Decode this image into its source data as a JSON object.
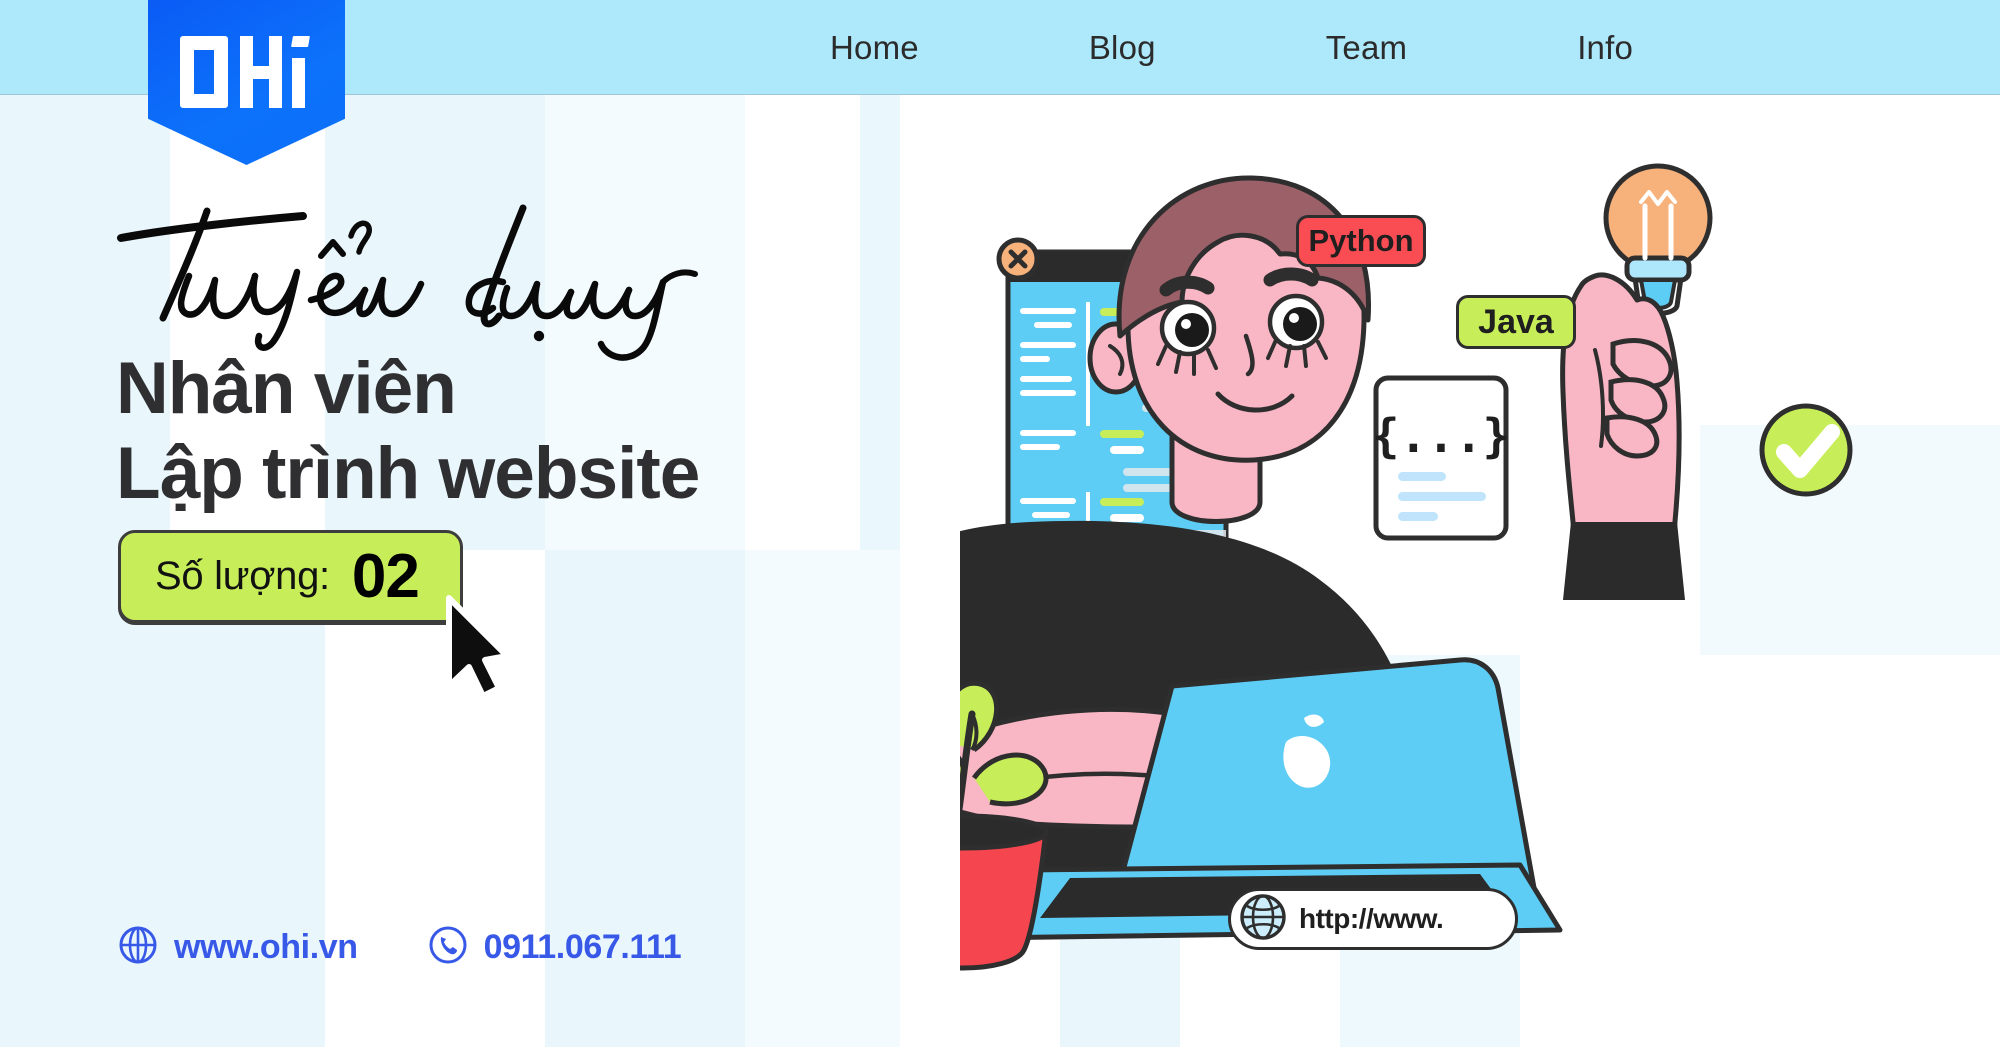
{
  "brand": {
    "logo_text": "OHi",
    "logo_color": "#0d72fb"
  },
  "nav": {
    "items": [
      {
        "label": "Home"
      },
      {
        "label": "Blog"
      },
      {
        "label": "Team"
      },
      {
        "label": "Info"
      }
    ]
  },
  "hero": {
    "script_text": "Tuyển dụng",
    "title_line1": "Nhân viên",
    "title_line2": "Lập trình website",
    "quantity_label": "Số lượng:",
    "quantity_value": "02",
    "quantity_badge_color": "#c7ee59"
  },
  "contacts": [
    {
      "icon": "globe-icon",
      "text": "www.ohi.vn"
    },
    {
      "icon": "phone-icon",
      "text": "0911.067.111"
    }
  ],
  "illustration": {
    "chips": [
      {
        "label": "Python",
        "color": "#fa4c53"
      },
      {
        "label": "Java",
        "color": "#c7ee59"
      }
    ],
    "url_chip": {
      "icon": "globe-icon",
      "text": "http://www."
    },
    "code_card_text": "{...}",
    "accent_colors": {
      "sky": "#5ecdf5",
      "pink": "#f9b6c4",
      "lime": "#c7ee59",
      "red": "#f5464f",
      "dark": "#2e2e2e",
      "hair": "#9b6068",
      "bulb": "#f7b27c"
    }
  },
  "theme": {
    "nav_bg": "#ade8fb",
    "stripe_light": "#e9f7fd",
    "stripe_white": "#ffffff",
    "text_dark": "#2f2f31",
    "link_blue": "#3858e8"
  }
}
